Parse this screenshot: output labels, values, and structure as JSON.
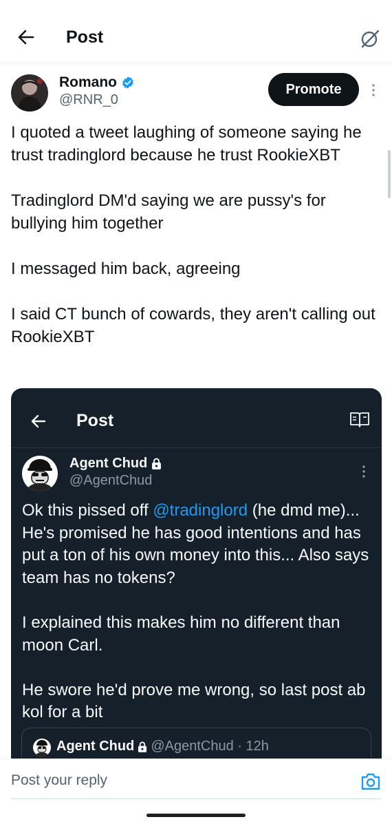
{
  "header": {
    "title": "Post"
  },
  "author": {
    "name": "Romano",
    "handle": "@RNR_0",
    "promote_label": "Promote"
  },
  "tweet": {
    "text": "I quoted a tweet laughing of someone saying he trust tradinglord because he trust RookieXBT\n\nTradinglord DM'd saying we are pussy's for bullying him together\n\nI messaged him back, agreeing\n\nI said CT bunch of cowards, they aren't calling out RookieXBT"
  },
  "embed": {
    "header_title": "Post",
    "author_name": "Agent Chud",
    "author_handle": "@AgentChud",
    "text_before_mention": "Ok this pissed off ",
    "mention": "@tradinglord",
    "text_after_mention": " (he dmd me)... He's promised he has good intentions and has put a ton of his own money into this...  Also says team has no tokens?",
    "para2": "I explained this makes him no different than moon Carl.",
    "para3": "He swore he'd prove me wrong, so last post ab kol for a bit",
    "quote": {
      "name": "Agent Chud",
      "handle_time": "@AgentChud · 12h"
    }
  },
  "reply": {
    "placeholder": "Post your reply"
  },
  "colors": {
    "accent": "#1d9bf0",
    "embed_bg": "#15202b",
    "verified": "#1d9bf0"
  }
}
